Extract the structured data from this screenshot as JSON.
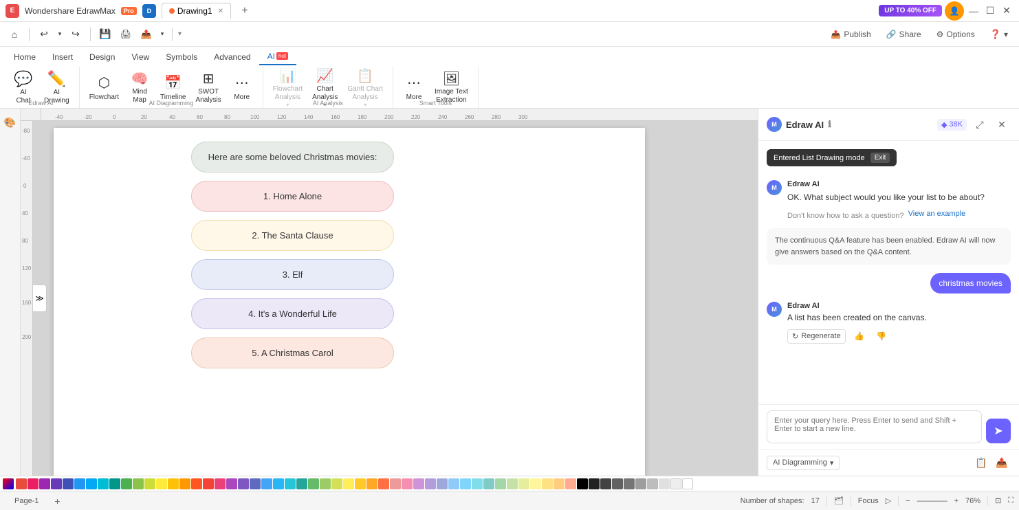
{
  "app": {
    "name": "Wondershare EdrawMax",
    "pro_badge": "Pro",
    "tab_name": "Drawing1",
    "promo": "UP TO 40% OFF"
  },
  "titlebar": {
    "minimize": "—",
    "maximize": "☐",
    "close": "✕"
  },
  "toolbar": {
    "home_icon": "⌂",
    "undo": "↩",
    "undo_arrow": "▾",
    "redo": "↪",
    "save": "💾",
    "print": "🖨",
    "export": "📤",
    "export_arrow": "▾",
    "more": "▾",
    "publish": "Publish",
    "share": "Share",
    "options": "Options",
    "help": "?"
  },
  "ribbon": {
    "tabs": [
      "Home",
      "Insert",
      "Design",
      "View",
      "Symbols",
      "Advanced",
      "AI"
    ],
    "ai_hot": "hot",
    "groups": {
      "edraw_ai": {
        "label": "Edraw AI",
        "items": [
          {
            "id": "ai-chat",
            "label": "AI\nChat",
            "icon": "💬"
          },
          {
            "id": "ai-drawing",
            "label": "AI\nDrawing",
            "icon": "✏️"
          }
        ]
      },
      "ai_diagramming": {
        "label": "AI Diagramming",
        "items": [
          {
            "id": "flowchart",
            "label": "Flowchart",
            "icon": "⬡"
          },
          {
            "id": "mindmap",
            "label": "Mind\nMap",
            "icon": "🧠"
          },
          {
            "id": "timeline",
            "label": "Timeline",
            "icon": "📅"
          },
          {
            "id": "swot",
            "label": "SWOT\nAnalysis",
            "icon": "⊞"
          },
          {
            "id": "more-diag",
            "label": "More",
            "icon": "⋯"
          }
        ]
      },
      "ai_analysis": {
        "label": "AI Analysis",
        "items": [
          {
            "id": "flowchart-analysis",
            "label": "Flowchart\nAnalysis",
            "icon": "📊",
            "disabled": true
          },
          {
            "id": "chart-analysis",
            "label": "Chart\nAnalysis",
            "icon": "📈",
            "disabled": false
          },
          {
            "id": "gantt-analysis",
            "label": "Gantt Chart\nAnalysis",
            "icon": "📋",
            "disabled": true
          }
        ]
      },
      "smart_tools": {
        "label": "Smart Tools",
        "items": [
          {
            "id": "more-tools",
            "label": "More",
            "icon": "⋯"
          },
          {
            "id": "image-text",
            "label": "Image Text\nExtraction",
            "icon": "🖼"
          }
        ]
      }
    }
  },
  "canvas": {
    "zoom": "76%",
    "shape_count": "17",
    "page_name": "Page-1"
  },
  "drawing": {
    "title_card": "Here are some beloved Christmas movies:",
    "items": [
      {
        "id": 1,
        "label": "1. Home Alone",
        "color": "#fce4e4",
        "border": "#f0c0c0"
      },
      {
        "id": 2,
        "label": "2. The Santa Clause",
        "color": "#fff8e8",
        "border": "#f0e0b0"
      },
      {
        "id": 3,
        "label": "3. Elf",
        "color": "#e8ecf8",
        "border": "#c0c8e8"
      },
      {
        "id": 4,
        "label": "4. It's a Wonderful Life",
        "color": "#ece8f8",
        "border": "#c8c0e8"
      },
      {
        "id": 5,
        "label": "5. A Christmas Carol",
        "color": "#fce8e0",
        "border": "#f0c8b0"
      }
    ],
    "title_bg": "#e8ece8",
    "title_border": "#c0d0c0"
  },
  "ai_panel": {
    "title": "Edraw AI",
    "token_count": "38K",
    "mode_banner": "Entered List Drawing mode",
    "exit_label": "Exit",
    "question": "OK. What subject would you like your list to be about?",
    "help_text": "Don't know how to ask a question?",
    "view_example": "View an example",
    "qa_info": "The continuous Q&A feature has been enabled. Edraw AI will now give answers based on the Q&A content.",
    "user_message": "christmas movies",
    "ai_response_sender": "Edraw AI",
    "ai_response_text": "A list has been created on the canvas.",
    "regenerate_label": "Regenerate",
    "input_placeholder": "Enter your query here. Press Enter to send and Shift + Enter to start a new line.",
    "ai_mode": "AI Diagramming",
    "send_icon": "➤"
  },
  "colors": [
    "#e74c3c",
    "#e91e63",
    "#9c27b0",
    "#673ab7",
    "#3f51b5",
    "#2196f3",
    "#03a9f4",
    "#00bcd4",
    "#009688",
    "#4caf50",
    "#8bc34a",
    "#cddc39",
    "#ffeb3b",
    "#ffc107",
    "#ff9800",
    "#ff5722",
    "#f44336",
    "#ec407a",
    "#ab47bc",
    "#7e57c2",
    "#5c6bc0",
    "#42a5f5",
    "#29b6f6",
    "#26c6da",
    "#26a69a",
    "#66bb6a",
    "#9ccc65",
    "#d4e157",
    "#ffee58",
    "#ffca28",
    "#ffa726",
    "#ff7043",
    "#ef9a9a",
    "#f48fb1",
    "#ce93d8",
    "#b39ddb",
    "#9fa8da",
    "#90caf9",
    "#81d4fa",
    "#80deea",
    "#80cbc4",
    "#a5d6a7",
    "#c5e1a5",
    "#e6ee9c",
    "#fff59d",
    "#ffe082",
    "#ffcc80",
    "#ffab91",
    "#000000",
    "#212121",
    "#424242",
    "#616161",
    "#757575",
    "#9e9e9e",
    "#bdbdbd",
    "#e0e0e0",
    "#eeeeee",
    "#ffffff",
    "#3e2723",
    "#4e342e",
    "#5d4037",
    "#6d4c41",
    "#795548",
    "#8d6e63",
    "#a1887f",
    "#bcaaa4",
    "#d7ccc8",
    "#efebe9",
    "#1a237e",
    "#283593",
    "#303f9f",
    "#3949ab",
    "#3f51b5",
    "#5c6bc0",
    "#7986cb",
    "#9fa8da",
    "#c5cae9",
    "#e8eaf6"
  ],
  "ruler": {
    "h_ticks": [
      "-40",
      "-20",
      "0",
      "20",
      "40",
      "60",
      "80",
      "100",
      "120",
      "140",
      "160",
      "180",
      "200",
      "~220",
      "~240",
      "~260",
      "~280",
      "300"
    ],
    "v_ticks": [
      "-80",
      "-40",
      "0",
      "40",
      "80",
      "120",
      "160",
      "200"
    ]
  },
  "status": {
    "shapes_label": "Number of shapes:",
    "shapes_count": "17",
    "focus_label": "Focus",
    "zoom_label": "76%"
  }
}
